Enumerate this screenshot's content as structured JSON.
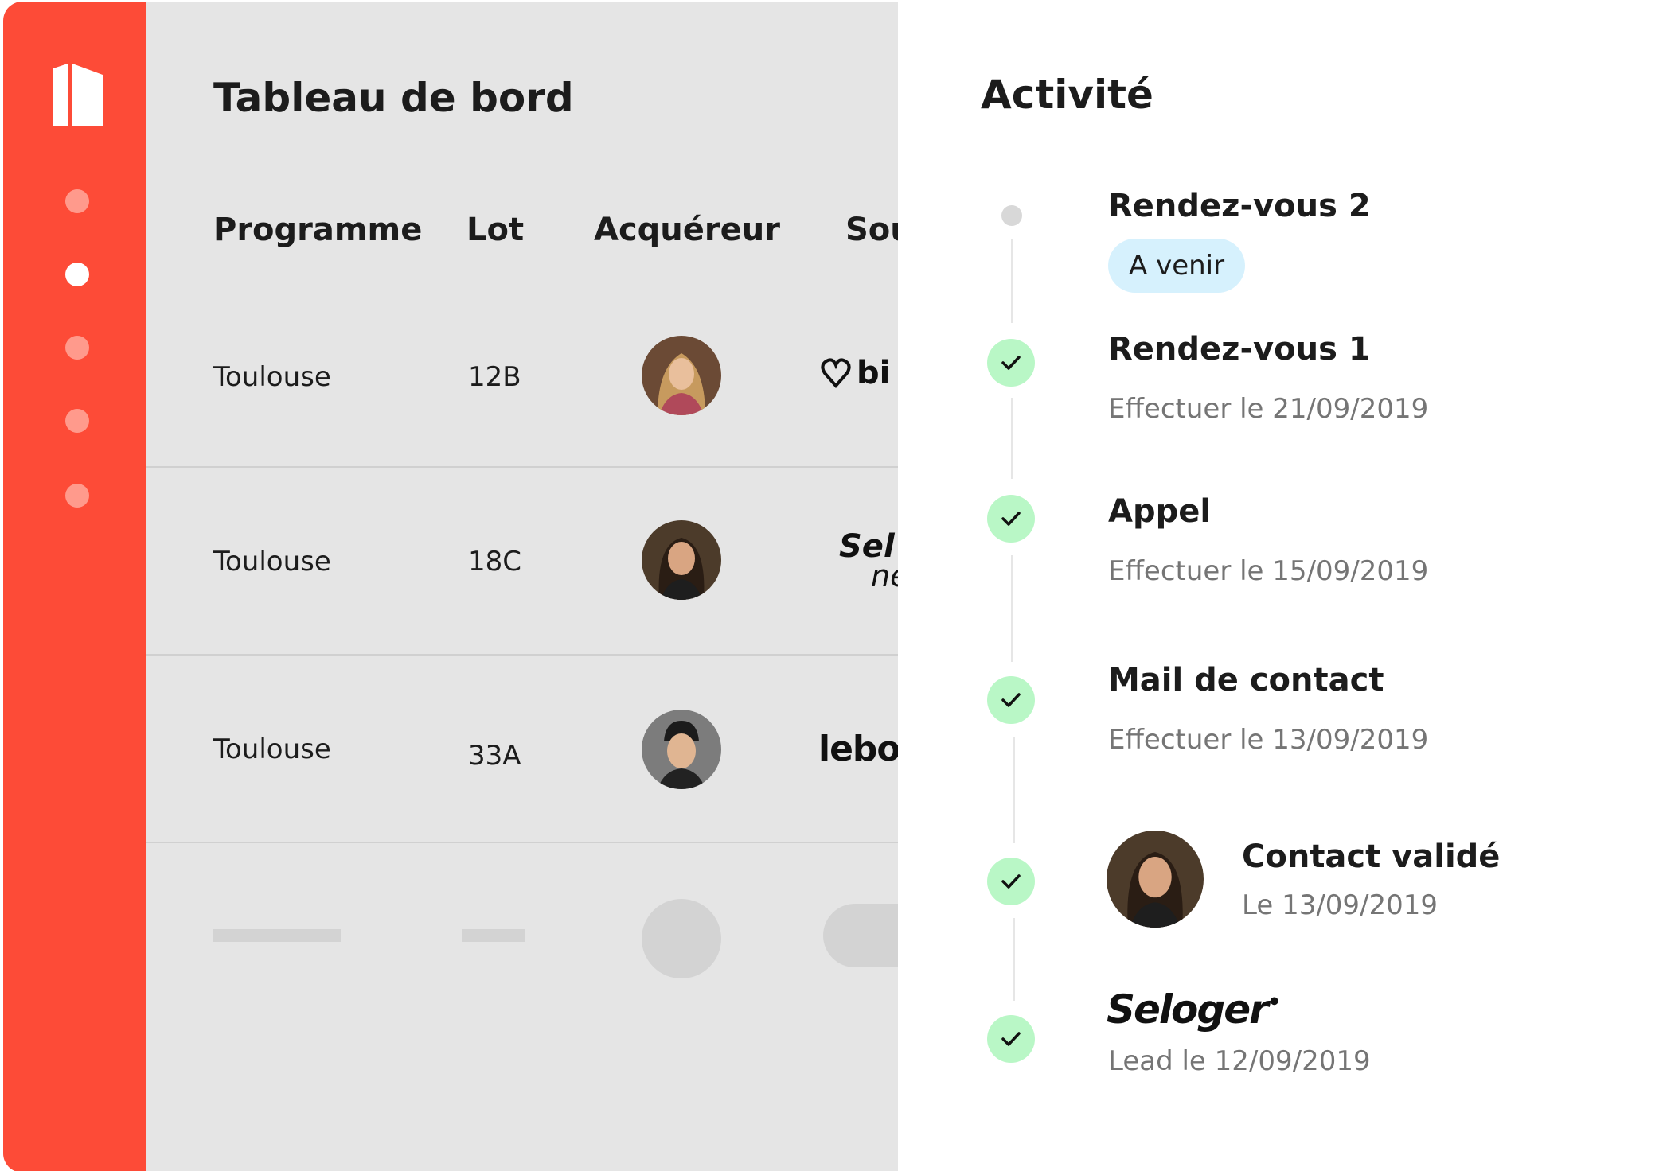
{
  "sidebar": {
    "logo_icon": "building-logo-icon",
    "nav": [
      {
        "icon": "nav-dot-icon",
        "active": false
      },
      {
        "icon": "nav-dot-icon",
        "active": true
      },
      {
        "icon": "nav-dot-icon",
        "active": false
      },
      {
        "icon": "nav-dot-icon",
        "active": false
      },
      {
        "icon": "nav-dot-icon",
        "active": false
      }
    ]
  },
  "dashboard": {
    "title": "Tableau de bord",
    "columns": [
      "Programme",
      "Lot",
      "Acquéreur",
      "Sou"
    ],
    "rows": [
      {
        "programme": "Toulouse",
        "lot": "12B",
        "buyer_avatar": "avatar-woman-blonde",
        "source_logo": "bi"
      },
      {
        "programme": "Toulouse",
        "lot": "18C",
        "buyer_avatar": "avatar-woman-brunette",
        "source_logo": "Sel",
        "source_logo_sub": "ne"
      },
      {
        "programme": "Toulouse",
        "lot": "33A",
        "buyer_avatar": "avatar-man-beanie",
        "source_logo": "lebo"
      }
    ]
  },
  "activity": {
    "title": "Activité",
    "events": [
      {
        "title": "Rendez-vous 2",
        "badge": "A venir",
        "status": "pending"
      },
      {
        "title": "Rendez-vous 1",
        "subtitle": "Effectuer le 21/09/2019",
        "status": "done"
      },
      {
        "title": "Appel",
        "subtitle": "Effectuer le 15/09/2019",
        "status": "done"
      },
      {
        "title": "Mail de contact",
        "subtitle": "Effectuer le 13/09/2019",
        "status": "done"
      },
      {
        "title": "Contact validé",
        "subtitle": "Le 13/09/2019",
        "status": "done",
        "avatar": "avatar-woman-brunette"
      },
      {
        "logo": "Seloger",
        "subtitle": "Lead le 12/09/2019",
        "status": "done"
      }
    ]
  },
  "colors": {
    "sidebar": "#fd4b37",
    "nav_dot": "#ff9a8c",
    "main_bg": "#e5e5e5",
    "check_bg": "#b9f7c6",
    "badge_bg": "#d6f1fd"
  }
}
